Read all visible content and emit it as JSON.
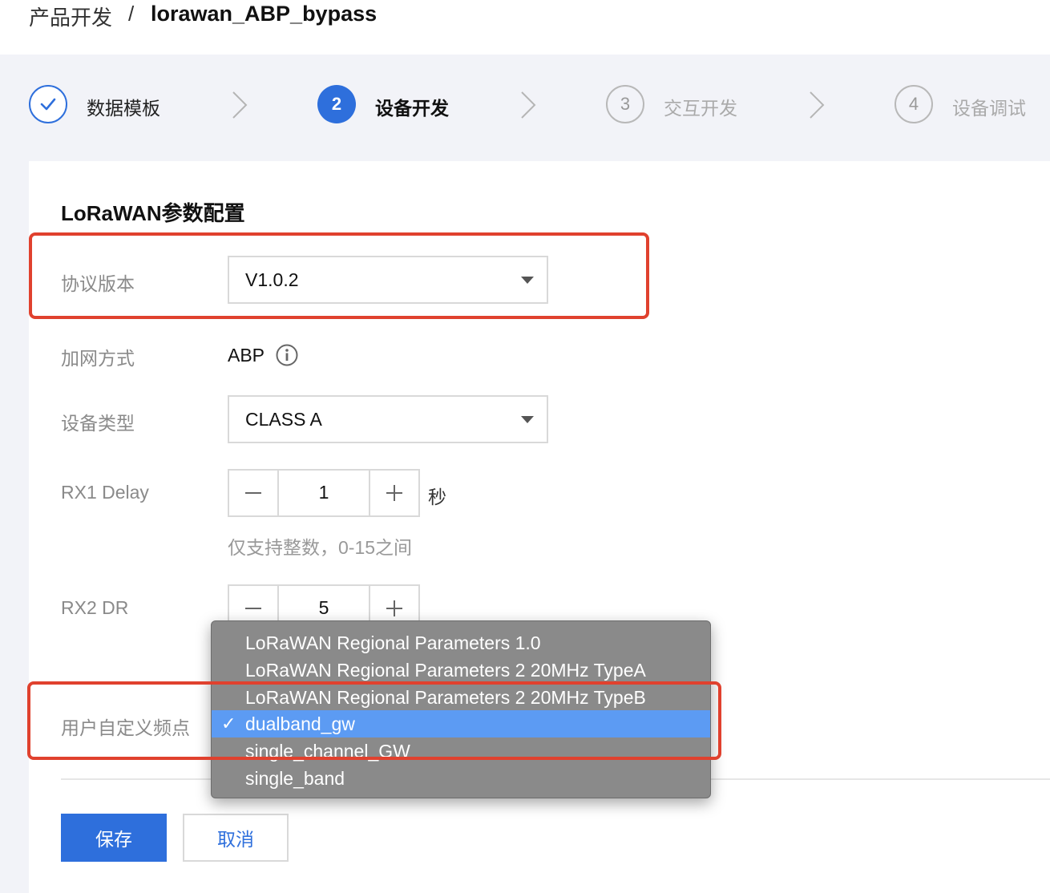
{
  "breadcrumb": {
    "root": "产品开发",
    "separator": "/",
    "current": "lorawan_ABP_bypass"
  },
  "steps": [
    {
      "number": "",
      "label": "数据模板",
      "state": "done"
    },
    {
      "number": "2",
      "label": "设备开发",
      "state": "active"
    },
    {
      "number": "3",
      "label": "交互开发",
      "state": "todo"
    },
    {
      "number": "4",
      "label": "设备调试",
      "state": "todo"
    }
  ],
  "section": {
    "title": "LoRaWAN参数配置"
  },
  "form": {
    "protocol_version": {
      "label": "协议版本",
      "value": "V1.0.2"
    },
    "join_method": {
      "label": "加网方式",
      "value": "ABP"
    },
    "device_type": {
      "label": "设备类型",
      "value": "CLASS A"
    },
    "rx1_delay": {
      "label": "RX1 Delay",
      "value": "1",
      "unit": "秒",
      "hint": "仅支持整数，0-15之间"
    },
    "rx2_dr": {
      "label": "RX2 DR",
      "value": "5"
    },
    "custom_freq": {
      "label": "用户自定义频点"
    }
  },
  "dropdown": {
    "check_mark": "✓",
    "options": [
      {
        "label": "LoRaWAN Regional Parameters 1.0"
      },
      {
        "label": "LoRaWAN Regional Parameters 2 20MHz TypeA"
      },
      {
        "label": "LoRaWAN Regional Parameters 2 20MHz TypeB"
      },
      {
        "label": "dualband_gw",
        "selected": true
      },
      {
        "label": "single_channel_GW"
      },
      {
        "label": "single_band"
      }
    ]
  },
  "actions": {
    "save_label": "保存",
    "cancel_label": "取消"
  },
  "colors": {
    "primary": "#2e6fdc",
    "annotation_red": "#e0412e",
    "dropdown_bg": "#8a8a8a",
    "dropdown_selected": "#5c9bf3",
    "page_grey": "#f2f3f8"
  }
}
